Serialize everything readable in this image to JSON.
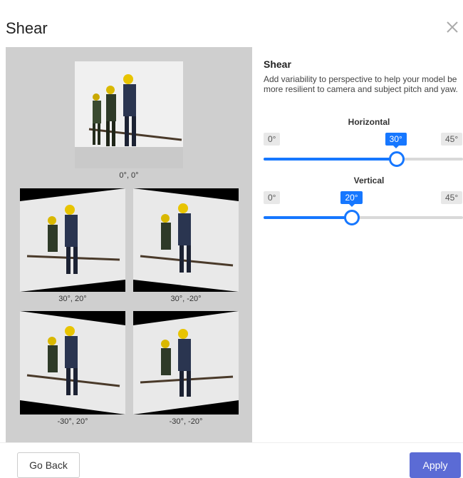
{
  "dialog": {
    "title": "Shear",
    "close_icon": "close-icon"
  },
  "preview": {
    "original_caption": "0°, 0°",
    "grid": [
      {
        "caption": "30°, 20°"
      },
      {
        "caption": "30°, -20°"
      },
      {
        "caption": "-30°, 20°"
      },
      {
        "caption": "-30°, -20°"
      }
    ]
  },
  "settings": {
    "title": "Shear",
    "description": "Add variability to perspective to help your model be more resilient to camera and subject pitch and yaw.",
    "horizontal": {
      "label": "Horizontal",
      "min_label": "0°",
      "max_label": "45°",
      "value_label": "30°",
      "value": 30,
      "max": 45
    },
    "vertical": {
      "label": "Vertical",
      "min_label": "0°",
      "max_label": "45°",
      "value_label": "20°",
      "value": 20,
      "max": 45
    }
  },
  "footer": {
    "back_label": "Go Back",
    "apply_label": "Apply"
  },
  "colors": {
    "accent": "#1677ff",
    "apply": "#5b6bd5"
  }
}
